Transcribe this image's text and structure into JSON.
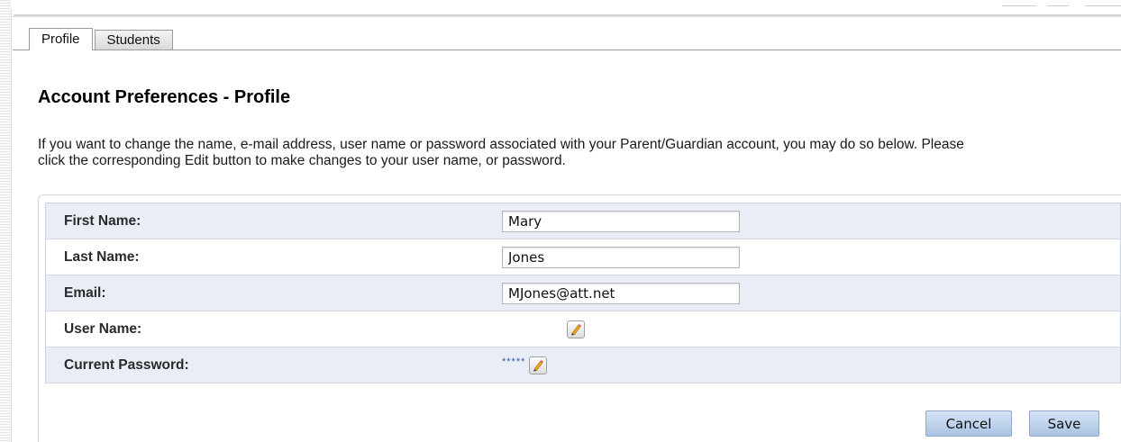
{
  "tabs": [
    {
      "label": "Profile",
      "active": true
    },
    {
      "label": "Students",
      "active": false
    }
  ],
  "page": {
    "title": "Account Preferences - Profile",
    "description_line1": "If you want to change the name, e-mail address, user name or password associated with your Parent/Guardian account, you may do so below. Please",
    "description_line2": "click the corresponding Edit button to make changes to your user name, or password."
  },
  "form": {
    "first_name": {
      "label": "First Name:",
      "value": "Mary"
    },
    "last_name": {
      "label": "Last Name:",
      "value": "Jones"
    },
    "email": {
      "label": "Email:",
      "value": "MJones@att.net"
    },
    "user_name": {
      "label": "User Name:",
      "edit_icon": "pencil-icon"
    },
    "current_password": {
      "label": "Current Password:",
      "masked_value": "*****",
      "edit_icon": "pencil-icon"
    }
  },
  "actions": {
    "cancel_label": "Cancel",
    "save_label": "Save"
  },
  "colors": {
    "row_shaded": "#e9eef6",
    "button_fill": "#b9d0ec",
    "masked_text": "#2b5ea8"
  }
}
